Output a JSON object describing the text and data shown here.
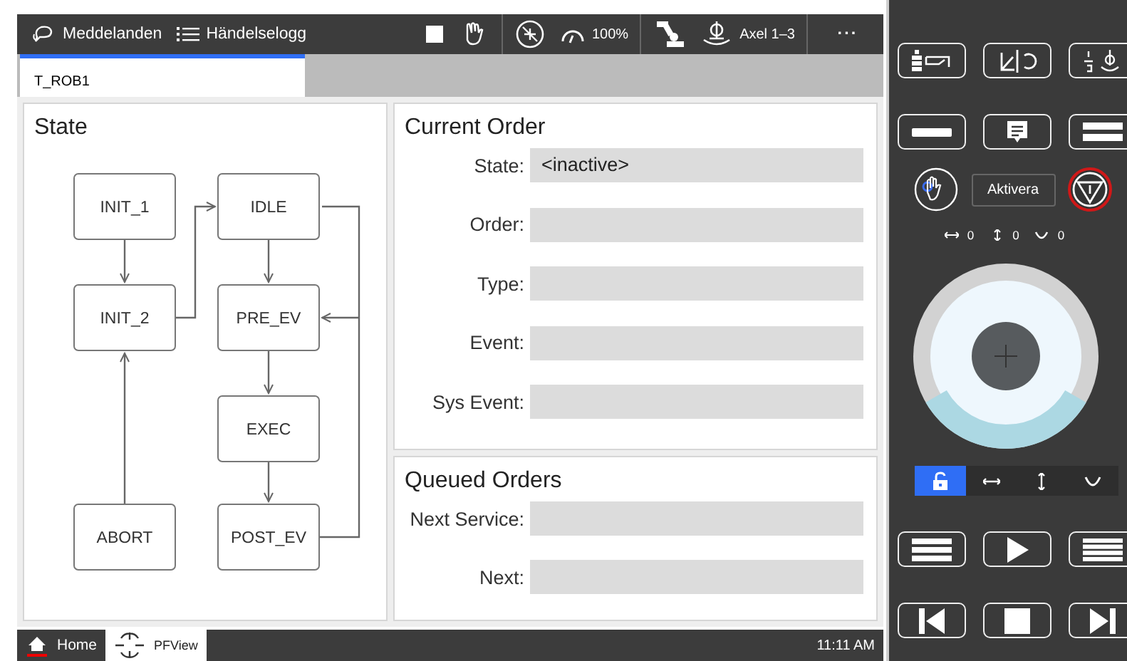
{
  "top_bar": {
    "messages": "Meddelanden",
    "event_log": "Händelselogg",
    "speed": "100%",
    "axes": "Axel 1–3",
    "more": "···"
  },
  "tabs": [
    {
      "label": "T_ROB1",
      "selected": true
    }
  ],
  "state_panel": {
    "title": "State",
    "nodes": [
      {
        "label": "INIT_1"
      },
      {
        "label": "IDLE"
      },
      {
        "label": "INIT_2"
      },
      {
        "label": "PRE_EV"
      },
      {
        "label": "EXEC"
      },
      {
        "label": "ABORT"
      },
      {
        "label": "POST_EV"
      }
    ]
  },
  "current_order": {
    "title": "Current Order",
    "fields": [
      {
        "label": "State:",
        "value": "<inactive>"
      },
      {
        "label": "Order:"
      },
      {
        "label": "Type:"
      },
      {
        "label": "Event:"
      },
      {
        "label": "Sys Event:"
      }
    ]
  },
  "queued_orders": {
    "title": "Queued Orders",
    "fields": [
      {
        "label": "Next Service:"
      },
      {
        "label": "Next:"
      }
    ]
  },
  "pendant": {
    "activate": "Aktivera",
    "readings": [
      "0",
      "0",
      "0"
    ],
    "jog_modes": [
      {
        "kind": "lock",
        "selected": true
      },
      {
        "kind": "linear",
        "selected": false
      },
      {
        "kind": "vertical",
        "selected": false
      },
      {
        "kind": "rotate",
        "selected": false
      }
    ]
  },
  "taskbar": [
    {
      "label": "Home",
      "kind": "home",
      "selected": false
    },
    {
      "label": "PFView",
      "kind": "pfview",
      "selected": true
    }
  ],
  "clock": "11:11 AM"
}
